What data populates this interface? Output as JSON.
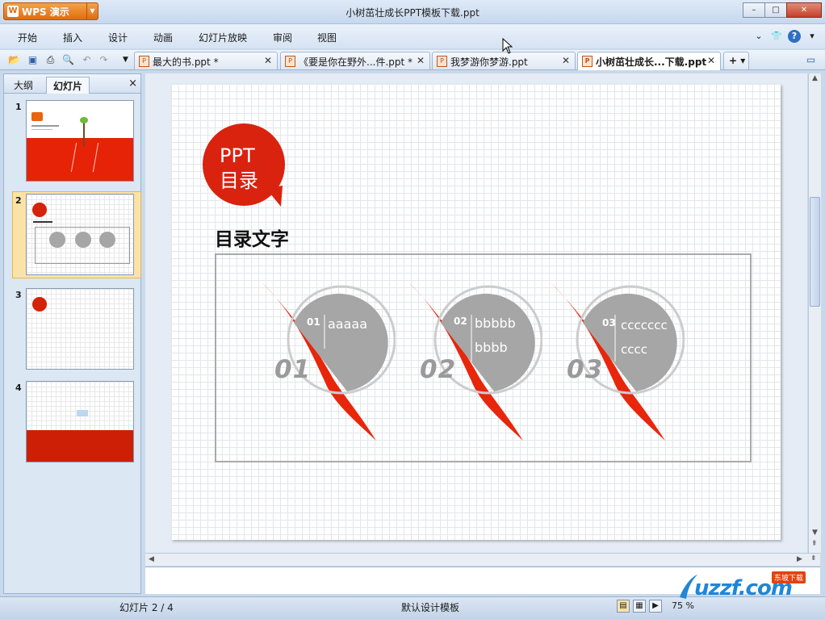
{
  "window": {
    "app_name": "WPS 演示",
    "title": "小树茁壮成长PPT模板下载.ppt",
    "controls": {
      "minimize": "–",
      "restore": "□",
      "close": "✕"
    }
  },
  "menu": {
    "items": [
      "开始",
      "插入",
      "设计",
      "动画",
      "幻灯片放映",
      "审阅",
      "视图"
    ]
  },
  "tabs": [
    {
      "label": "最大的书.ppt *",
      "active": false
    },
    {
      "label": "《要是你在野外...件.ppt *",
      "active": false
    },
    {
      "label": "我梦游你梦游.ppt",
      "active": false
    },
    {
      "label": "小树茁壮成长...下载.ppt",
      "active": true
    }
  ],
  "left_pane": {
    "tab_outline": "大纲",
    "tab_slides": "幻灯片",
    "close": "×",
    "slides": [
      {
        "number": "1",
        "selected": false
      },
      {
        "number": "2",
        "selected": true
      },
      {
        "number": "3",
        "selected": false
      },
      {
        "number": "4",
        "selected": false
      }
    ]
  },
  "slide": {
    "badge_line1": "PPT",
    "badge_line2": "目录",
    "heading": "目录文字",
    "items": [
      {
        "small_num": "01",
        "text_line1": "aaaaa",
        "text_line2": "",
        "big_num": "01"
      },
      {
        "small_num": "02",
        "text_line1": "bbbbb",
        "text_line2": "bbbb",
        "big_num": "02"
      },
      {
        "small_num": "03",
        "text_line1": "ccccccc",
        "text_line2": "cccc",
        "big_num": "03"
      }
    ]
  },
  "status": {
    "slide_counter": "幻灯片 2 / 4",
    "template": "默认设计模板",
    "zoom": "75 %"
  },
  "watermark": {
    "text": "uzzf.com",
    "tag": "东坡下载"
  },
  "colors": {
    "accent_red": "#d9230f",
    "circle_gray": "#a6a6a6",
    "wps_orange": "#e06c12"
  }
}
